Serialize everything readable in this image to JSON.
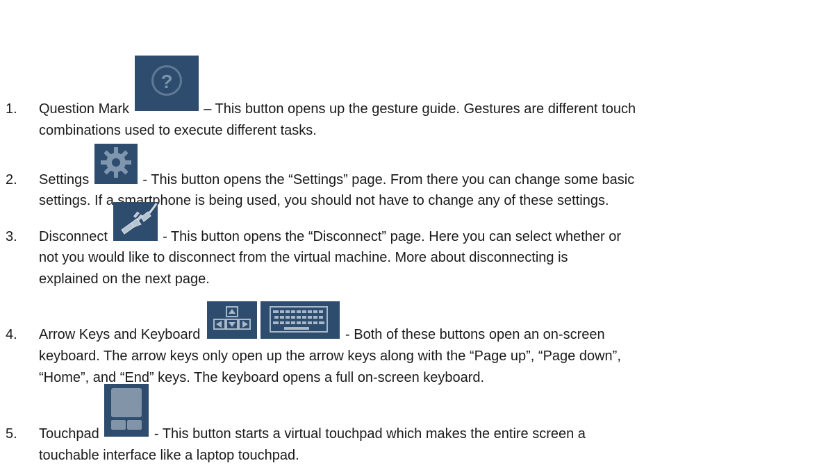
{
  "items": [
    {
      "number": "1.",
      "name": "Question Mark",
      "icon": "question-mark-icon",
      "desc1": "– This button opens up the gesture guide. Gestures are different touch",
      "desc2": "combinations used to execute different tasks."
    },
    {
      "number": "2.",
      "name": "Settings",
      "icon": "gear-icon",
      "desc1": "- This button opens the “Settings” page. From there you can change some basic",
      "desc2": "settings. If a smartphone is being used, you should not have to change any of these settings."
    },
    {
      "number": "3.",
      "name": "Disconnect",
      "icon": "plug-icon",
      "desc1": "- This button opens the “Disconnect” page. Here you can select whether or",
      "desc2": "not you would like to disconnect from the virtual machine. More about disconnecting is",
      "desc3": "explained on the next page."
    },
    {
      "number": "4.",
      "name": "Arrow Keys and Keyboard",
      "icon": "arrow-keys-icon",
      "icon2": "keyboard-icon",
      "desc1": "- Both of these buttons open an on-screen",
      "desc2": "keyboard. The arrow keys only open up the arrow keys along with the “Page up”, “Page down”,",
      "desc3": "“Home”, and “End” keys. The keyboard opens a full on-screen keyboard."
    },
    {
      "number": "5.",
      "name": "Touchpad",
      "icon": "touchpad-icon",
      "desc1": "- This button starts a virtual touchpad which makes the entire screen a",
      "desc2": "touchable interface like a laptop touchpad."
    }
  ]
}
